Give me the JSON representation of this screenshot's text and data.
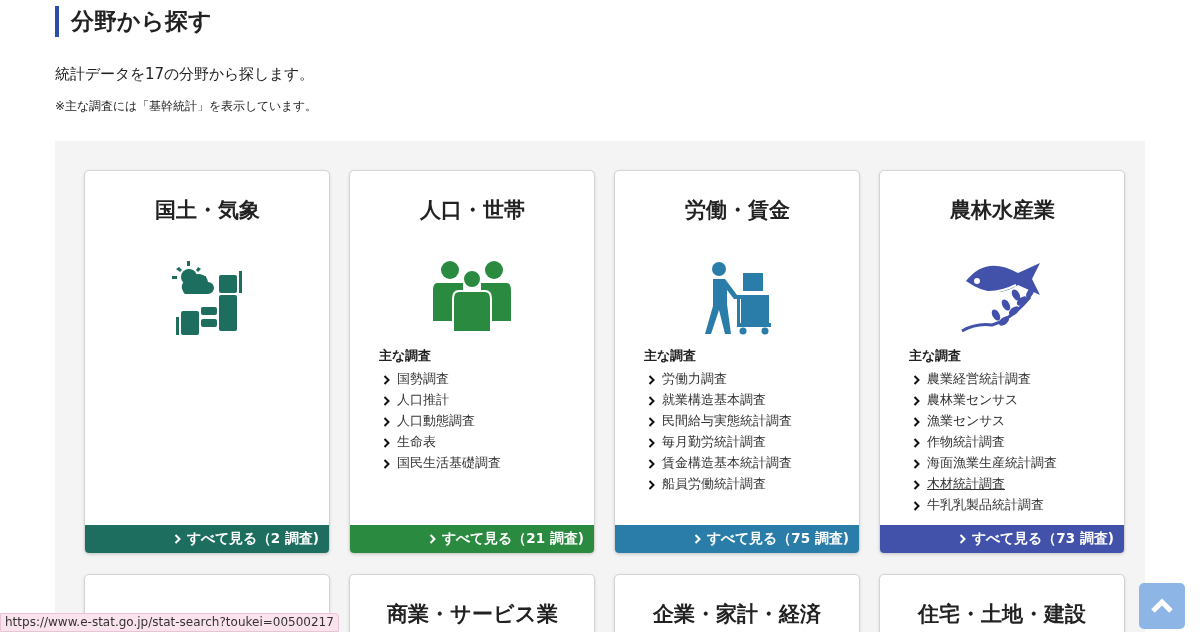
{
  "heading": "分野から探す",
  "intro": "統計データを17の分野から探します。",
  "note": "※主な調査には「基幹統計」を表示しています。",
  "cards": [
    {
      "kind": "category",
      "title": "国土・気象",
      "color": "#1e6e60",
      "more": "すべて見る（2 調査)"
    },
    {
      "kind": "category",
      "title": "人口・世帯",
      "color": "#2a8a3f",
      "items_label": "主な調査",
      "items": [
        {
          "label": "国勢調査",
          "hovered": false
        },
        {
          "label": "人口推計",
          "hovered": false
        },
        {
          "label": "人口動態調査",
          "hovered": false
        },
        {
          "label": "生命表",
          "hovered": false
        },
        {
          "label": "国民生活基礎調査",
          "hovered": false
        }
      ],
      "more": "すべて見る（21 調査)"
    },
    {
      "kind": "category",
      "title": "労働・賃金",
      "color": "#2a7da8",
      "items_label": "主な調査",
      "items": [
        {
          "label": "労働力調査",
          "hovered": false
        },
        {
          "label": "就業構造基本調査",
          "hovered": false
        },
        {
          "label": "民間給与実態統計調査",
          "hovered": false
        },
        {
          "label": "毎月勤労統計調査",
          "hovered": false
        },
        {
          "label": "賃金構造基本統計調査",
          "hovered": false
        },
        {
          "label": "船員労働統計調査",
          "hovered": false
        }
      ],
      "more": "すべて見る（75 調査)"
    },
    {
      "kind": "category",
      "title": "農林水産業",
      "color": "#4252aa",
      "items_label": "主な調査",
      "items": [
        {
          "label": "農業経営統計調査",
          "hovered": false
        },
        {
          "label": "農林業センサス",
          "hovered": false
        },
        {
          "label": "漁業センサス",
          "hovered": false
        },
        {
          "label": "作物統計調査",
          "hovered": false
        },
        {
          "label": "海面漁業生産統計調査",
          "hovered": false
        },
        {
          "label": "木材統計調査",
          "hovered": true
        },
        {
          "label": "牛乳乳製品統計調査",
          "hovered": false
        }
      ],
      "more": "すべて見る（73 調査)"
    },
    {
      "kind": "covered"
    },
    {
      "kind": "category",
      "title": "商業・サービス業"
    },
    {
      "kind": "category",
      "title": "企業・家計・経済"
    },
    {
      "kind": "category",
      "title": "住宅・土地・建設"
    }
  ],
  "status_bar": "https://www.e-stat.go.jp/stat-search?toukei=00500217"
}
